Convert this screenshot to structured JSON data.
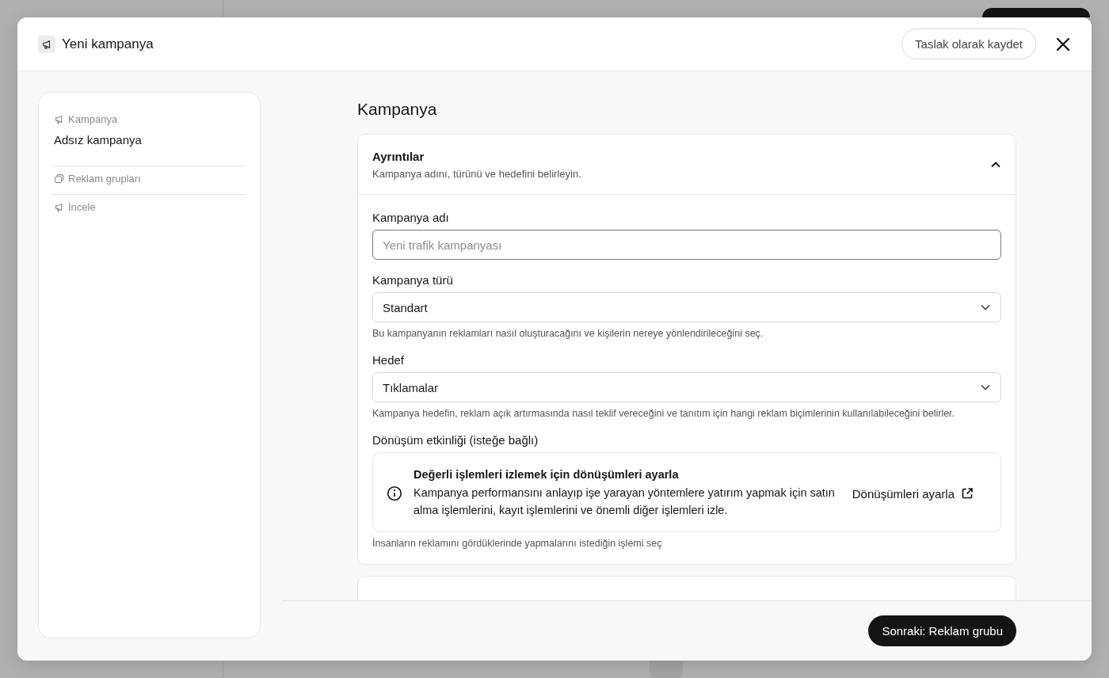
{
  "dialog": {
    "title": "Yeni kampanya",
    "save_draft_button": "Taslak olarak kaydet"
  },
  "steps": [
    {
      "kind": "megaphone",
      "label": "Kampanya",
      "value": "Adsız kampanya"
    },
    {
      "kind": "stack",
      "label": "Reklam grupları"
    },
    {
      "kind": "megaphone",
      "label": "İncele"
    }
  ],
  "section_title": "Kampanya",
  "details_card": {
    "title": "Ayrıntılar",
    "subtitle": "Kampanya adını, türünü ve hedefini belirleyin.",
    "expanded": true,
    "fields": [
      {
        "kind": "text",
        "label": "Kampanya adı",
        "placeholder": "Yeni trafik kampanyası"
      },
      {
        "kind": "select",
        "label": "Kampanya türü",
        "value": "Standart",
        "hint": "Bu kampanyanın reklamları nasıl oluşturacağını ve kişilerin nereye yönlendirileceğini seç."
      },
      {
        "kind": "select",
        "label": "Hedef",
        "value": "Tıklamalar",
        "hint": "Kampanya hedefin, reklam açık artırmasında nasıl teklif vereceğini ve tanıtım için hangi reklam biçimlerinin kullanılabileceğini belirler."
      },
      {
        "kind": "callout",
        "label": "Dönüşüm etkinliği (isteğe bağlı)",
        "callout_title": "Değerli işlemleri izlemek için dönüşümleri ayarla",
        "callout_text": "Kampanya performansını anlayıp işe yarayan yöntemlere yatırım yapmak için satın alma işlemlerini, kayıt işlemlerini ve önemli diğer işlemleri izle.",
        "link": "Dönüşümleri ayarla",
        "hint": "İnsanların reklamını gördüklerinde yapmalarını istediğin işlemi seç"
      }
    ]
  },
  "next_button": "Sonraki: Reklam grubu"
}
